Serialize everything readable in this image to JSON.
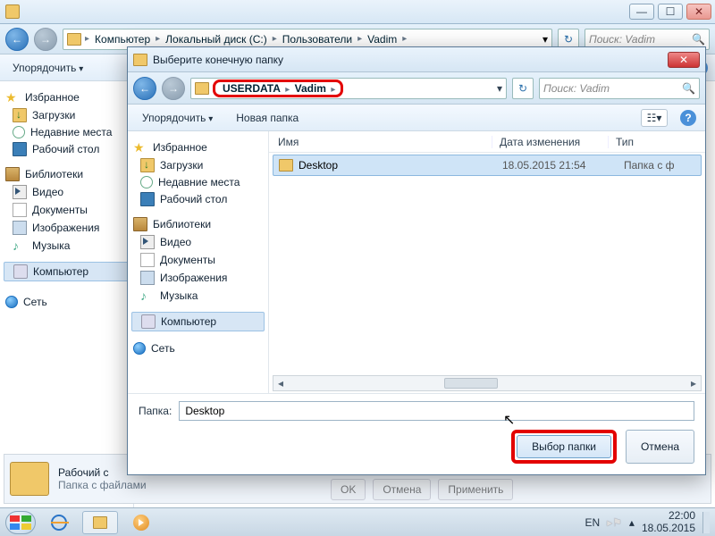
{
  "outer": {
    "title": "",
    "breadcrumb": [
      "Компьютер",
      "Локальный диск (C:)",
      "Пользователи",
      "Vadim"
    ],
    "search_placeholder": "Поиск: Vadim",
    "toolbar": {
      "organize": "Упорядочить"
    },
    "sidebar": {
      "favorites": {
        "label": "Избранное",
        "items": [
          "Загрузки",
          "Недавние места",
          "Рабочий стол"
        ]
      },
      "libraries": {
        "label": "Библиотеки",
        "items": [
          "Видео",
          "Документы",
          "Изображения",
          "Музыка"
        ]
      },
      "computer": "Компьютер",
      "network": "Сеть"
    },
    "status": {
      "line1": "Рабочий с",
      "line2": "Папка с файлами"
    },
    "ghost_buttons": [
      "OK",
      "Отмена",
      "Применить"
    ]
  },
  "dialog": {
    "title": "Выберите конечную папку",
    "breadcrumb": [
      "USERDATA",
      "Vadim"
    ],
    "search_placeholder": "Поиск: Vadim",
    "toolbar": {
      "organize": "Упорядочить",
      "new_folder": "Новая папка"
    },
    "sidebar": {
      "favorites": {
        "label": "Избранное",
        "items": [
          "Загрузки",
          "Недавние места",
          "Рабочий стол"
        ]
      },
      "libraries": {
        "label": "Библиотеки",
        "items": [
          "Видео",
          "Документы",
          "Изображения",
          "Музыка"
        ]
      },
      "computer": "Компьютер",
      "network": "Сеть"
    },
    "columns": {
      "name": "Имя",
      "date": "Дата изменения",
      "type": "Тип"
    },
    "rows": [
      {
        "name": "Desktop",
        "date": "18.05.2015 21:54",
        "type": "Папка с ф"
      }
    ],
    "folder_label": "Папка:",
    "folder_value": "Desktop",
    "select_btn": "Выбор папки",
    "cancel_btn": "Отмена"
  },
  "taskbar": {
    "lang": "EN",
    "time": "22:00",
    "date": "18.05.2015"
  }
}
